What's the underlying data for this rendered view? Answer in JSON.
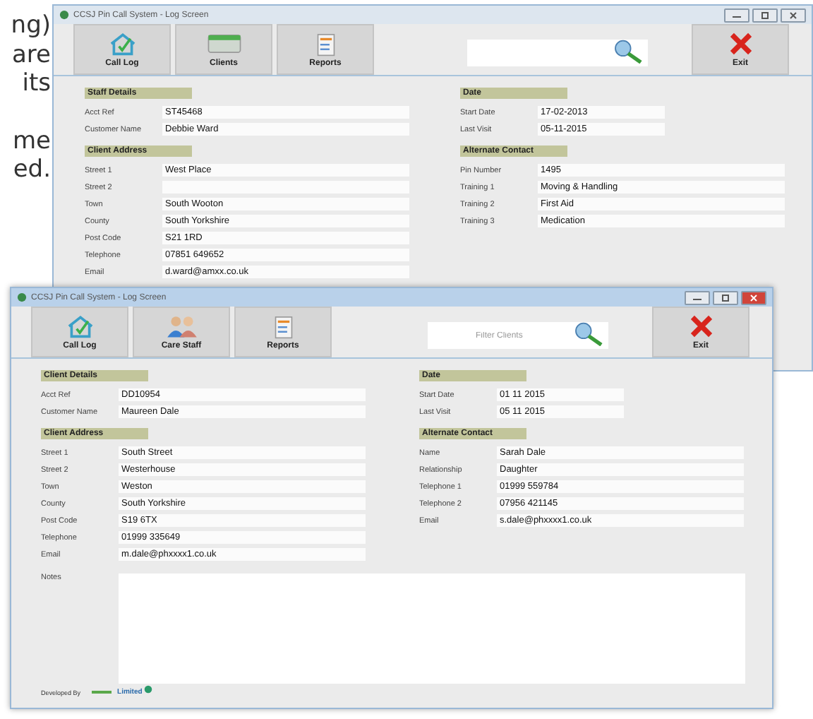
{
  "page_text": [
    [
      "ng)",
      "are",
      "its"
    ],
    [
      "me",
      "ed."
    ]
  ],
  "windows": [
    {
      "title": "CCSJ Pin Call System - Log Screen",
      "active": false,
      "toolbar": [
        {
          "label": "Call Log",
          "kind": "home"
        },
        {
          "label": "Clients",
          "kind": "card"
        },
        {
          "label": "Reports",
          "kind": "document"
        }
      ],
      "exit": {
        "label": "Exit"
      },
      "left_sections": [
        {
          "title": "Staff Details",
          "fields": [
            {
              "label": "Acct Ref",
              "value": "ST45468"
            },
            {
              "label": "Customer Name",
              "value": "Debbie Ward"
            }
          ]
        },
        {
          "title": "Client Address",
          "fields": [
            {
              "label": "Street 1",
              "value": "West Place"
            },
            {
              "label": "Street 2"
            },
            {
              "label": "Town",
              "value": "South Wooton"
            },
            {
              "label": "County",
              "value": "South Yorkshire"
            },
            {
              "label": "Post Code",
              "value": "S21 1RD"
            },
            {
              "label": "Telephone",
              "value": "07851 649652"
            },
            {
              "label": "Email",
              "value": "d.ward@amxx.co.uk"
            }
          ]
        }
      ],
      "right_sections": [
        {
          "title": "Date",
          "fields": [
            {
              "label": "Start Date",
              "value": "17-02-2013"
            },
            {
              "label": "Last Visit",
              "value": "05-11-2015"
            }
          ]
        },
        {
          "title": "Alternate Contact",
          "fields": [
            {
              "label": "Pin Number",
              "value": "1495"
            },
            {
              "label": "Training 1",
              "value": "Moving & Handling"
            },
            {
              "label": "Training 2",
              "value": "First Aid"
            },
            {
              "label": "Training 3",
              "value": "Medication"
            }
          ]
        }
      ]
    },
    {
      "title": "CCSJ Pin Call System - Log Screen",
      "active": true,
      "toolbar": [
        {
          "label": "Call Log",
          "kind": "home"
        },
        {
          "label": "Care Staff",
          "kind": "people"
        },
        {
          "label": "Reports",
          "kind": "document"
        }
      ],
      "search": {
        "placeholder": "Filter Clients"
      },
      "exit": {
        "label": "Exit"
      },
      "left_sections": [
        {
          "title": "Client Details",
          "fields": [
            {
              "label": "Acct Ref",
              "value": "DD10954"
            },
            {
              "label": "Customer Name",
              "value": "Maureen Dale"
            }
          ]
        },
        {
          "title": "Client Address",
          "fields": [
            {
              "label": "Street 1",
              "value": "South Street"
            },
            {
              "label": "Street 2",
              "value": "Westerhouse"
            },
            {
              "label": "Town",
              "value": "Weston"
            },
            {
              "label": "County",
              "value": "South Yorkshire"
            },
            {
              "label": "Post Code",
              "value": "S19 6TX"
            },
            {
              "label": "Telephone",
              "value": "01999 335649"
            },
            {
              "label": "Email",
              "value": "m.dale@phxxxx1.co.uk"
            }
          ]
        }
      ],
      "right_sections": [
        {
          "title": "Date",
          "fields": [
            {
              "label": "Start Date",
              "value": "01 11 2015"
            },
            {
              "label": "Last Visit",
              "value": "05 11 2015"
            }
          ]
        },
        {
          "title": "Alternate Contact",
          "fields": [
            {
              "label": "Name",
              "value": "Sarah Dale"
            },
            {
              "label": "Relationship",
              "value": "Daughter"
            },
            {
              "label": "Telephone 1",
              "value": "01999 559784"
            },
            {
              "label": "Telephone 2",
              "value": "07956 421145"
            },
            {
              "label": "Email",
              "value": "s.dale@phxxxx1.co.uk"
            }
          ]
        }
      ],
      "notes": {
        "label": "Notes"
      },
      "footer": {
        "label": "Developed By",
        "company": "Limited"
      }
    }
  ]
}
